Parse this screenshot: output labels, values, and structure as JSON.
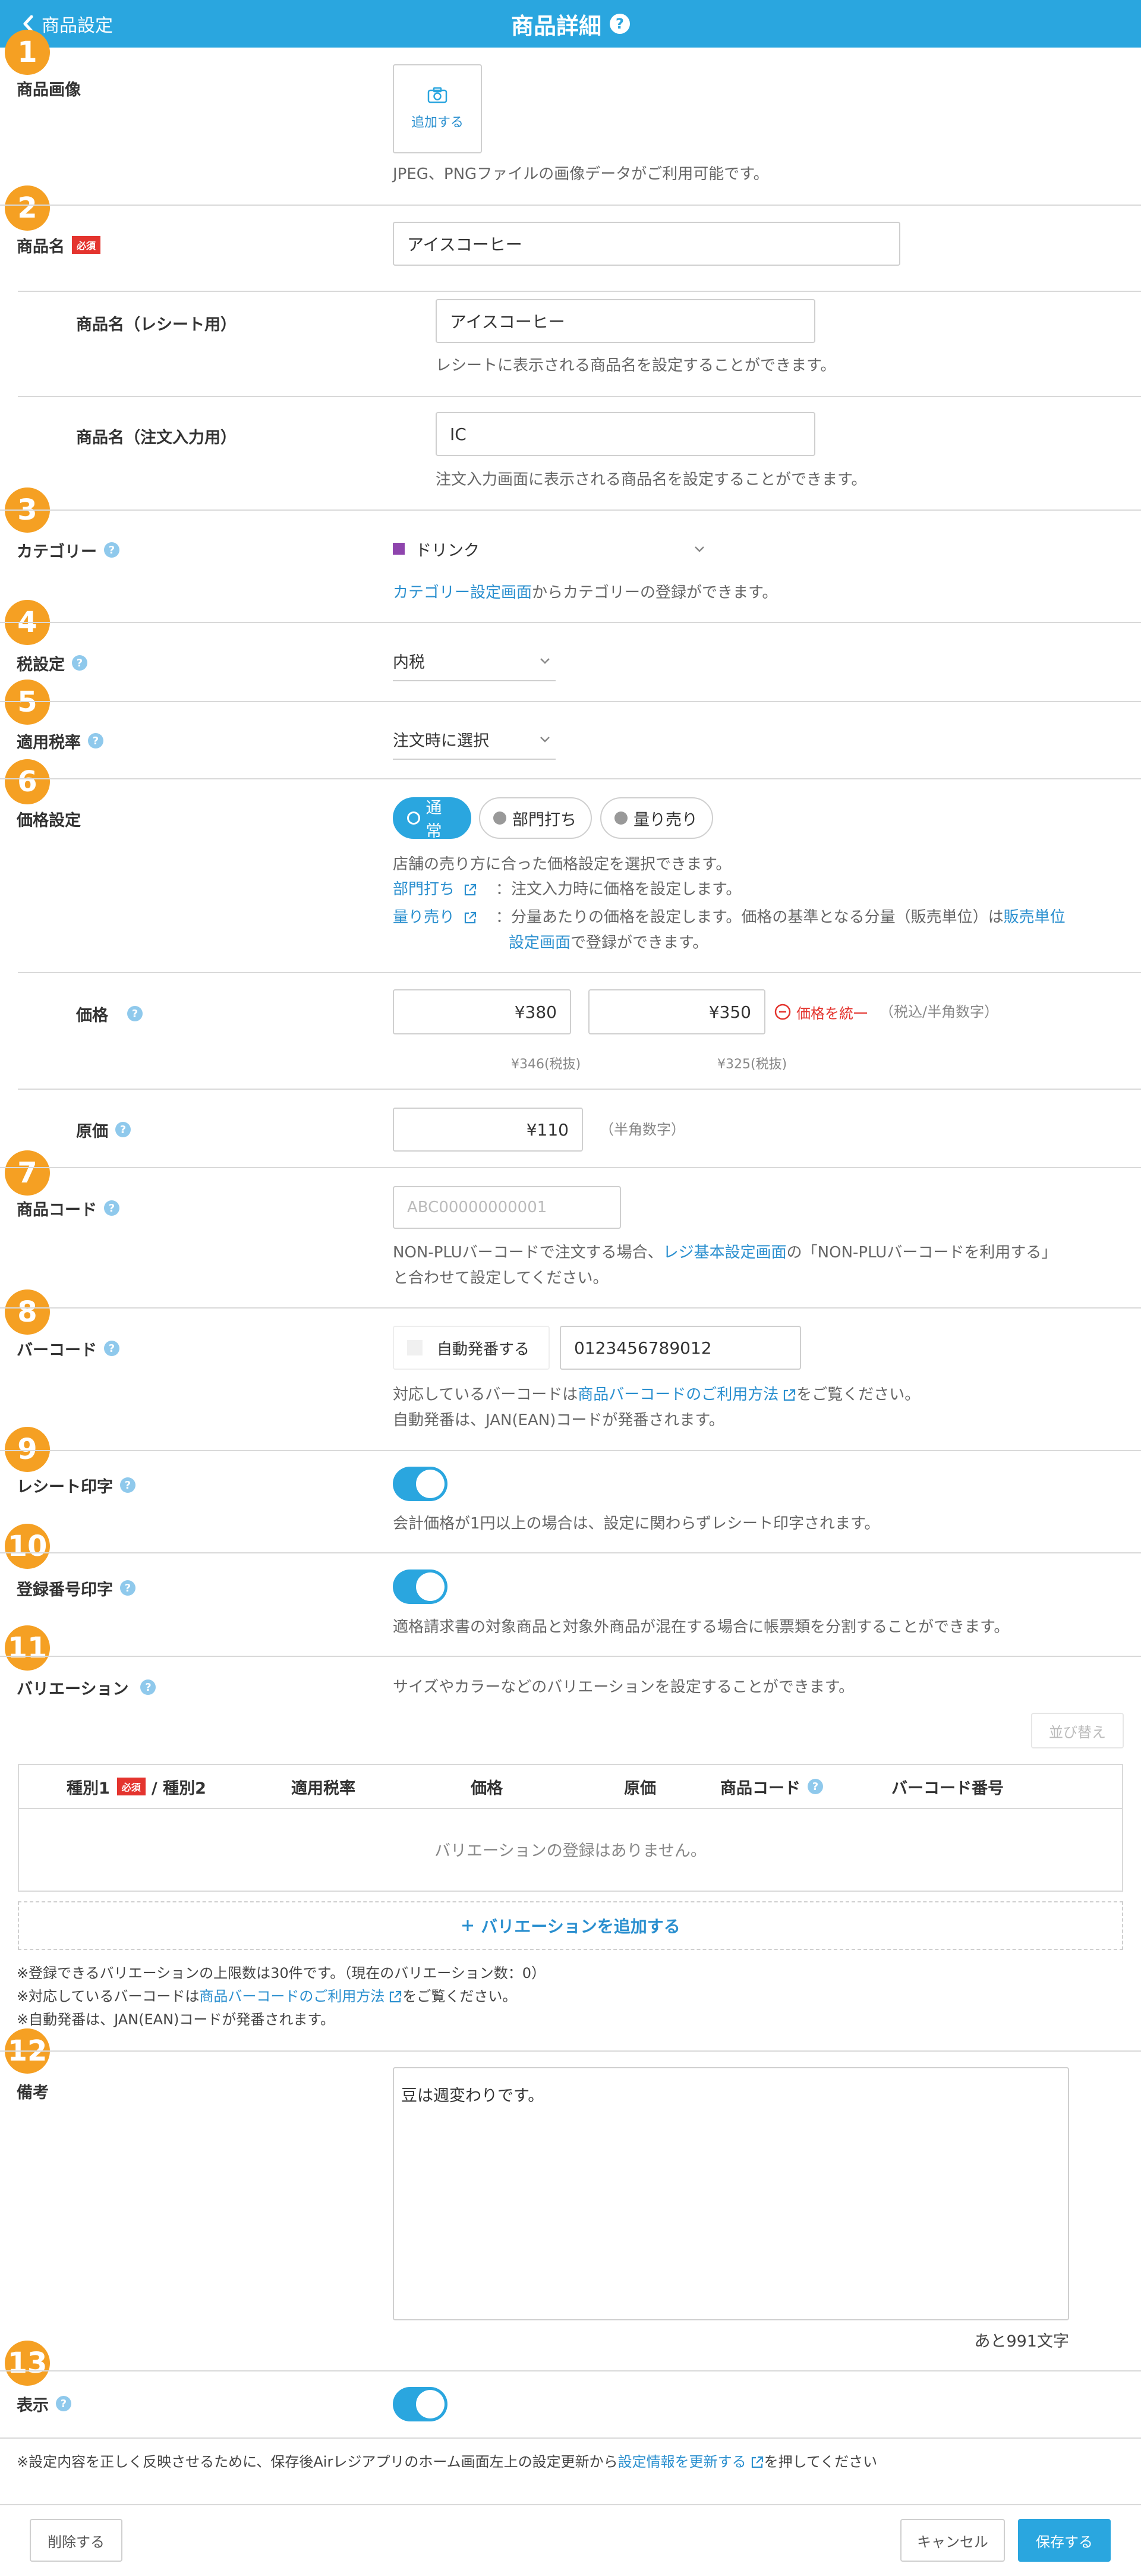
{
  "header": {
    "back_label": "商品設定",
    "title": "商品詳細",
    "help": "?"
  },
  "badges": [
    "1",
    "2",
    "3",
    "4",
    "5",
    "6",
    "7",
    "8",
    "9",
    "10",
    "11",
    "12",
    "13"
  ],
  "image": {
    "label": "商品画像",
    "add_label": "追加する",
    "help": "JPEG、PNGファイルの画像データがご利用可能です。"
  },
  "name": {
    "label": "商品名",
    "required": "必須",
    "value": "アイスコーヒー"
  },
  "receipt_name": {
    "label": "商品名（レシート用）",
    "value": "アイスコーヒー",
    "help": "レシートに表示される商品名を設定することができます。"
  },
  "order_name": {
    "label": "商品名（注文入力用）",
    "value": "IC",
    "help": "注文入力画面に表示される商品名を設定することができます。"
  },
  "category": {
    "label": "カテゴリー",
    "value": "ドリンク",
    "color": "#8e44ad",
    "help_link": "カテゴリー設定画面",
    "help_rest": "からカテゴリーの登録ができます。"
  },
  "tax": {
    "label": "税設定",
    "value": "内税"
  },
  "tax_rate": {
    "label": "適用税率",
    "value": "注文時に選択"
  },
  "pricing": {
    "label": "価格設定",
    "options": [
      "通常",
      "部門打ち",
      "量り売り"
    ],
    "selected": "通常",
    "help": "店舗の売り方に合った価格設定を選択できます。",
    "dept_link": "部門打ち",
    "dept_desc": "：注文入力時に価格を設定します。",
    "weight_link": "量り売り",
    "weight_desc_1": "：分量あたりの価格を設定します。価格の基準となる分量（販売単位）は",
    "weight_desc_link_1": "販売単位",
    "weight_desc_link_2": "設定画面",
    "weight_desc_2": "で登録ができます。"
  },
  "price": {
    "label": "価格",
    "value1": "¥380",
    "value2": "¥350",
    "unify": "価格を統一",
    "note": "（税込/半角数字）",
    "excl1": "¥346(税抜)",
    "excl2": "¥325(税抜)"
  },
  "cost": {
    "label": "原価",
    "value": "¥110",
    "note": "（半角数字）"
  },
  "code": {
    "label": "商品コード",
    "placeholder": "ABC00000000001",
    "help_1": "NON-PLUバーコードで注文する場合、",
    "help_link": "レジ基本設定画面",
    "help_2": "の「NON-PLUバーコードを利用する」",
    "help_3": "と合わせて設定してください。"
  },
  "barcode": {
    "label": "バーコード",
    "auto_label": "自動発番する",
    "value": "0123456789012",
    "help_1": "対応しているバーコードは",
    "help_link": "商品バーコードのご利用方法",
    "help_2": "をご覧ください。",
    "help_3": "自動発番は、JAN(EAN)コードが発番されます。"
  },
  "receipt_print": {
    "label": "レシート印字",
    "on": true,
    "help": "会計価格が1円以上の場合は、設定に関わらずレシート印字されます。"
  },
  "reg_print": {
    "label": "登録番号印字",
    "on": true,
    "help": "適格請求書の対象商品と対象外商品が混在する場合に帳票類を分割することができます。"
  },
  "variation": {
    "label": "バリエーション",
    "help": "サイズやカラーなどのバリエーションを設定することができます。",
    "sort_label": "並び替え",
    "columns": {
      "type1": "種別1",
      "required": "必須",
      "type2": "/ 種別2",
      "rate": "適用税率",
      "price": "価格",
      "cost": "原価",
      "code": "商品コード",
      "barcode": "バーコード番号"
    },
    "empty": "バリエーションの登録はありません。",
    "add_label": "バリエーションを追加する",
    "note_1": "※登録できるバリエーションの上限数は30件です。（現在のバリエーション数：0）",
    "note_2a": "※対応しているバーコードは",
    "note_2_link": "商品バーコードのご利用方法",
    "note_2b": "をご覧ください。",
    "note_3": "※自動発番は、JAN(EAN)コードが発番されます。"
  },
  "memo": {
    "label": "備考",
    "value": "豆は週変わりです。",
    "remaining": "あと991文字"
  },
  "display": {
    "label": "表示",
    "on": true
  },
  "footer": {
    "note_1": "※設定内容を正しく反映させるために、保存後Airレジアプリのホーム画面左上の設定更新から",
    "note_link": "設定情報を更新する",
    "note_2": "を押してください",
    "delete_label": "削除する",
    "cancel_label": "キャンセル",
    "save_label": "保存する"
  },
  "colors": {
    "accent": "#2aa6df",
    "badge": "#f5a023",
    "required": "#e4342e"
  }
}
